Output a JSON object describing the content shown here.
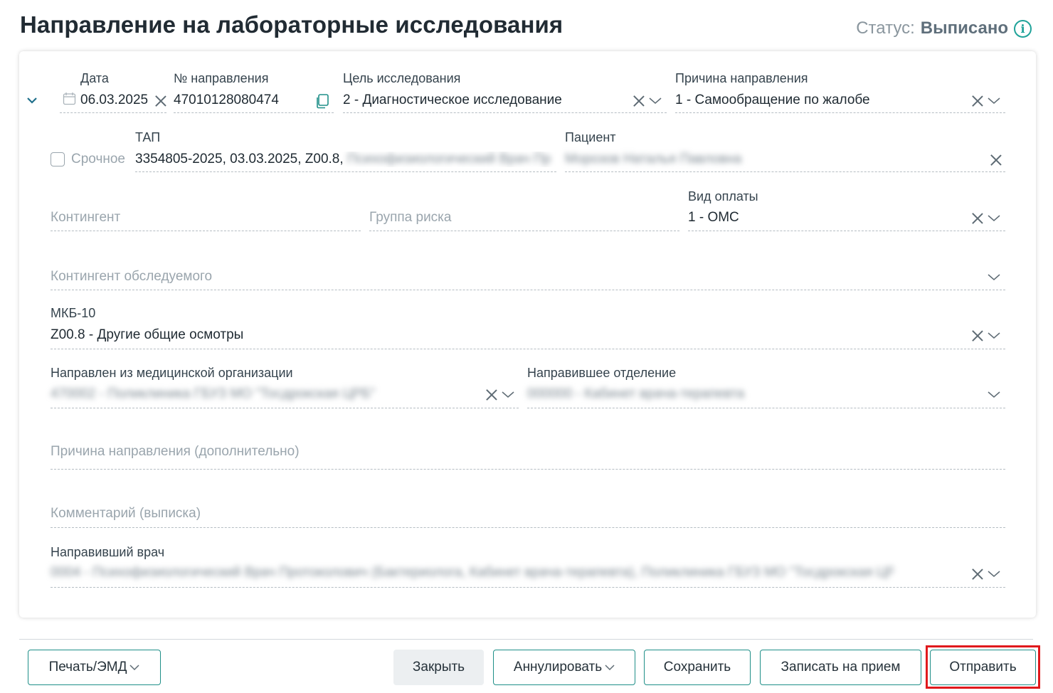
{
  "header": {
    "title": "Направление на лабораторные исследования",
    "status_label": "Статус:",
    "status_value": "Выписано",
    "info_icon": "info-circle-icon"
  },
  "form": {
    "date": {
      "label": "Дата",
      "value": "06.03.2025"
    },
    "referral_number": {
      "label": "№ направления",
      "value": "47010128080474"
    },
    "purpose": {
      "label": "Цель исследования",
      "value": "2 - Диагностическое исследование"
    },
    "reason": {
      "label": "Причина направления",
      "value": "1 - Самообращение по жалобе"
    },
    "urgent": {
      "label": "Срочное",
      "checked": false
    },
    "tap": {
      "label": "ТАП",
      "value": "3354805-2025, 03.03.2025, Z00.8,",
      "value_hidden": "Психофизиологический Врач Пр"
    },
    "patient": {
      "label": "Пациент",
      "value_hidden": "Морозов Наталья Павловна"
    },
    "contingent": {
      "placeholder": "Контингент"
    },
    "risk_group": {
      "placeholder": "Группа риска"
    },
    "payment": {
      "label": "Вид оплаты",
      "value": "1 - ОМС"
    },
    "examinee_contingent": {
      "placeholder": "Контингент обследуемого"
    },
    "mkb": {
      "label": "МКБ-10",
      "value": "Z00.8 - Другие общие осмотры"
    },
    "from_org": {
      "label": "Направлен из медицинской организации",
      "value_hidden": "470002 - Поликлиника ГБУЗ МО \"Тосдрокская ЦРБ\""
    },
    "from_dept": {
      "label": "Направившее отделение",
      "value_hidden": "000000 - Кабинет врача-терапевта"
    },
    "reason_extra": {
      "placeholder": "Причина направления (дополнительно)"
    },
    "comment": {
      "placeholder": "Комментарий (выписка)"
    },
    "doctor": {
      "label": "Направивший врач",
      "value_hidden": "0004 - Психофизиологический Врач Протоколович (Бактериолога, Кабинет врача-терапевта), Поликлиника ГБУЗ МО \"Тосдрокская ЦРБ\""
    }
  },
  "footer": {
    "print_button": "Печать/ЭМД",
    "close_button": "Закрыть",
    "annul_button": "Аннулировать",
    "save_button": "Сохранить",
    "appointment_button": "Записать на прием",
    "send_button": "Отправить"
  },
  "colors": {
    "accent": "#1f8f88",
    "highlight": "#e0191c"
  }
}
